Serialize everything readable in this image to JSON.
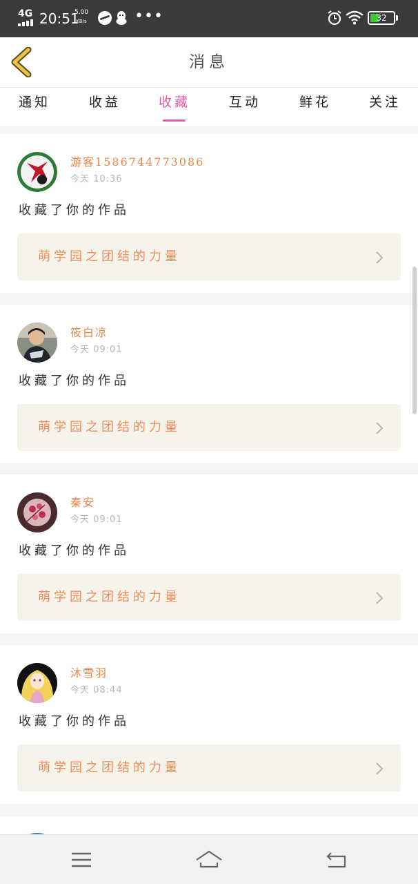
{
  "status_bar": {
    "network": "4G",
    "time": "20:51",
    "speed_value": "5.00",
    "speed_unit": "KB/s",
    "more": "•••",
    "battery": "32"
  },
  "header": {
    "title": "消息"
  },
  "tabs": [
    {
      "label": "通知",
      "active": false
    },
    {
      "label": "收益",
      "active": false
    },
    {
      "label": "收藏",
      "active": true
    },
    {
      "label": "互动",
      "active": false
    },
    {
      "label": "鲜花",
      "active": false
    },
    {
      "label": "关注",
      "active": false
    }
  ],
  "messages": [
    {
      "user": "游客1586744773086",
      "time": "今天 10:36",
      "action": "收藏了你的作品",
      "work": "萌学园之团结的力量",
      "avatar": "logo-avatar"
    },
    {
      "user": "筱白凉",
      "time": "今天 09:01",
      "action": "收藏了你的作品",
      "work": "萌学园之团结的力量",
      "avatar": "boy-photo-avatar"
    },
    {
      "user": "秦安",
      "time": "今天 09:01",
      "action": "收藏了你的作品",
      "work": "萌学园之团结的力量",
      "avatar": "flower-avatar"
    },
    {
      "user": "沐雪羽",
      "time": "今天 08:44",
      "action": "收藏了你的作品",
      "work": "萌学园之团结的力量",
      "avatar": "anime-girl-avatar"
    }
  ],
  "colors": {
    "accent": "#e05fa2",
    "username": "#e8874a",
    "work_title": "#ee8c5a",
    "work_bg": "#f6f4ea",
    "back_arrow": "#e9c34a",
    "status_bar_bg": "#3a3a3a"
  }
}
